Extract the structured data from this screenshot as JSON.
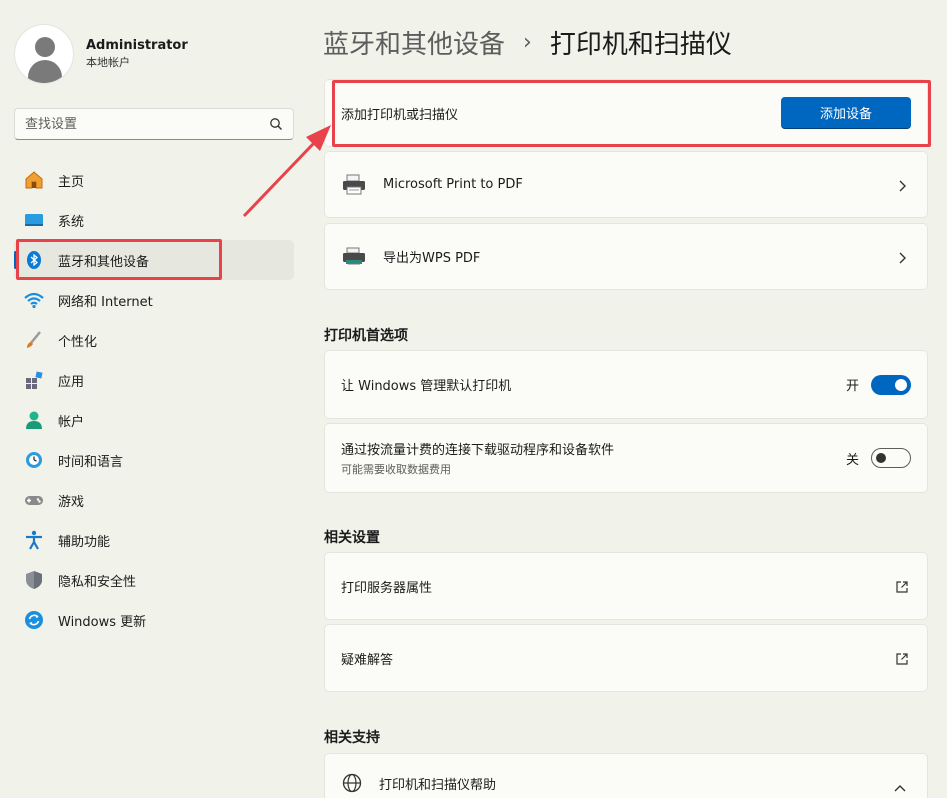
{
  "sidebar": {
    "profile": {
      "name": "Administrator",
      "account_type": "本地帐户"
    },
    "search": {
      "placeholder": "查找设置"
    },
    "items": [
      {
        "label": "主页",
        "icon": "home-icon"
      },
      {
        "label": "系统",
        "icon": "system-icon"
      },
      {
        "label": "蓝牙和其他设备",
        "icon": "bluetooth-icon",
        "active": true
      },
      {
        "label": "网络和 Internet",
        "icon": "wifi-icon"
      },
      {
        "label": "个性化",
        "icon": "brush-icon"
      },
      {
        "label": "应用",
        "icon": "apps-icon"
      },
      {
        "label": "帐户",
        "icon": "account-icon"
      },
      {
        "label": "时间和语言",
        "icon": "time-language-icon"
      },
      {
        "label": "游戏",
        "icon": "gaming-icon"
      },
      {
        "label": "辅助功能",
        "icon": "accessibility-icon"
      },
      {
        "label": "隐私和安全性",
        "icon": "shield-icon"
      },
      {
        "label": "Windows 更新",
        "icon": "update-icon"
      }
    ]
  },
  "header": {
    "parent": "蓝牙和其他设备",
    "separator": "›",
    "current": "打印机和扫描仪"
  },
  "add_printer": {
    "label": "添加打印机或扫描仪",
    "button": "添加设备"
  },
  "printers": [
    {
      "name": "Microsoft Print to PDF"
    },
    {
      "name": "导出为WPS PDF"
    }
  ],
  "preferences": {
    "title": "打印机首选项",
    "items": [
      {
        "label": "让 Windows 管理默认打印机",
        "state_label": "开",
        "on": true
      },
      {
        "label": "通过按流量计费的连接下载驱动程序和设备软件",
        "sub": "可能需要收取数据费用",
        "state_label": "关",
        "on": false
      }
    ]
  },
  "related_settings": {
    "title": "相关设置",
    "items": [
      {
        "label": "打印服务器属性"
      },
      {
        "label": "疑难解答"
      }
    ]
  },
  "related_support": {
    "title": "相关支持",
    "items": [
      {
        "label": "打印机和扫描仪帮助"
      }
    ]
  },
  "colors": {
    "accent": "#0067c0",
    "highlight": "#e8424a",
    "background": "#f1f3ea"
  }
}
